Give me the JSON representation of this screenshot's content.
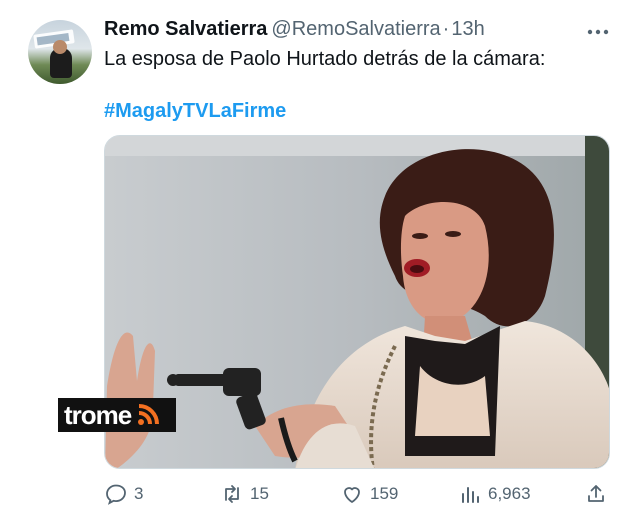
{
  "author": {
    "name": "Remo Salvatierra",
    "handle": "@RemoSalvatierra",
    "separator": "·",
    "time": "13h"
  },
  "tweet": {
    "text": "La esposa de Paolo Hurtado detrás de la cámara:",
    "hashtag": "#MagalyTVLaFirme"
  },
  "media": {
    "watermark": "trome"
  },
  "actions": {
    "replies": "3",
    "retweets": "15",
    "likes": "159",
    "views": "6,963"
  },
  "colors": {
    "accent": "#1d9bf0",
    "secondary_text": "#536471",
    "watermark_orange": "#f37021"
  }
}
